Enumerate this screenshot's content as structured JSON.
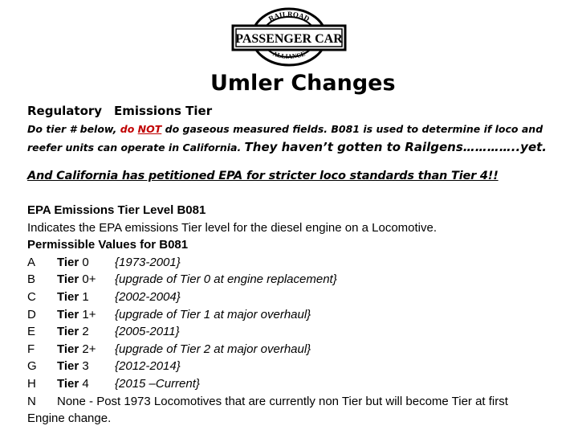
{
  "logo": {
    "top_arc": "RAILROAD",
    "banner": "PASSENGER CAR",
    "bottom_arc": "ALLIANCE"
  },
  "title": "Umler Changes",
  "subheader": {
    "col1": "Regulatory",
    "col2": "Emissions Tier"
  },
  "note": {
    "part1": "Do tier # below, ",
    "red_do": "do ",
    "red_not": "NOT",
    "part2": " do gaseous measured fields.  B081 is used to determine if loco and reefer units can operate in California.   ",
    "part3": "They haven’t gotten to Railgens…………..yet."
  },
  "petition": "And California has petitioned EPA for stricter loco standards than Tier 4!!",
  "section": {
    "heading": "EPA Emissions Tier Level B081",
    "description": "Indicates the EPA emissions Tier level for the diesel engine on a Locomotive.",
    "values_heading": "Permissible Values for B081",
    "tier_word": "Tier",
    "values": [
      {
        "code": "A",
        "tier": "0",
        "desc": "{1973-2001}"
      },
      {
        "code": "B",
        "tier": "0+",
        "desc": "{upgrade of Tier 0 at engine replacement}"
      },
      {
        "code": "C",
        "tier": "1",
        "desc": "{2002-2004}"
      },
      {
        "code": "D",
        "tier": "1+",
        "desc": "{upgrade of Tier 1 at major overhaul}"
      },
      {
        "code": "E",
        "tier": "2",
        "desc": "{2005-2011}"
      },
      {
        "code": "F",
        "tier": "2+",
        "desc": "{upgrade of Tier 2 at major overhaul}"
      },
      {
        "code": "G",
        "tier": "3",
        "desc": "{2012-2014}"
      },
      {
        "code": "H",
        "tier": "4",
        "desc": "{2015 –Current}"
      }
    ],
    "none_code": "N",
    "none_text": "None - Post 1973 Locomotives that are currently non Tier but will become Tier at first",
    "none_continuation": "Engine change."
  }
}
